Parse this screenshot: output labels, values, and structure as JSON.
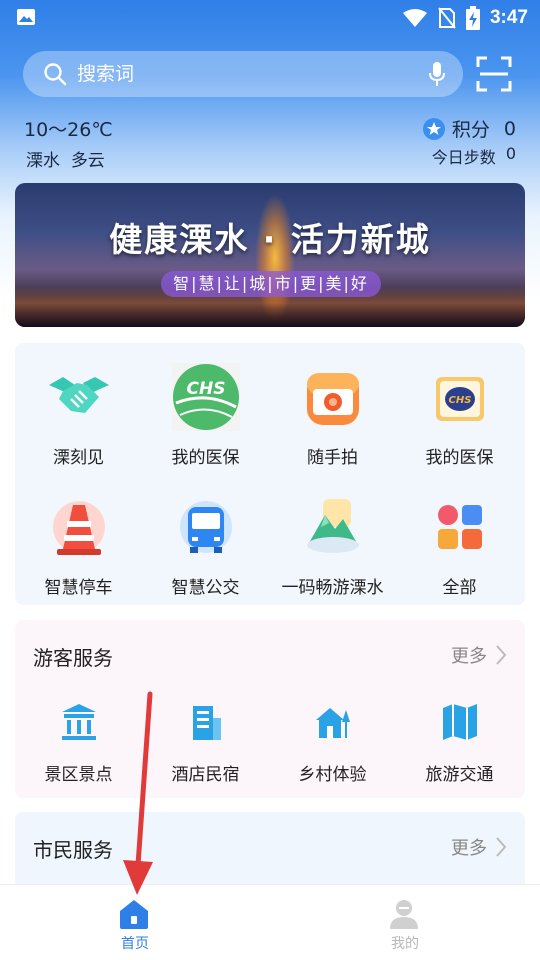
{
  "status_bar": {
    "time": "3:47"
  },
  "search": {
    "placeholder": "搜索词"
  },
  "weather": {
    "temperature": "10～26℃",
    "location": "溧水",
    "condition": "多云"
  },
  "points": {
    "label": "积分",
    "value": "0",
    "steps_label": "今日步数",
    "steps_value": "0"
  },
  "banner": {
    "title": "健康溧水 · 活力新城",
    "subtitle": "智|慧|让|城|市|更|美|好"
  },
  "apps": [
    {
      "label": "溧刻见",
      "icon": "handshake-icon"
    },
    {
      "label": "我的医保",
      "icon": "chs-green-icon"
    },
    {
      "label": "随手拍",
      "icon": "camera-icon"
    },
    {
      "label": "我的医保",
      "icon": "chs-card-icon"
    },
    {
      "label": "智慧停车",
      "icon": "traffic-cone-icon"
    },
    {
      "label": "智慧公交",
      "icon": "bus-icon"
    },
    {
      "label": "一码畅游溧水",
      "icon": "mountain-icon"
    },
    {
      "label": "全部",
      "icon": "grid-icon"
    }
  ],
  "tourist_service": {
    "title": "游客服务",
    "more": "更多",
    "items": [
      {
        "label": "景区景点",
        "icon": "temple-icon"
      },
      {
        "label": "酒店民宿",
        "icon": "building-icon"
      },
      {
        "label": "乡村体验",
        "icon": "house-icon"
      },
      {
        "label": "旅游交通",
        "icon": "map-icon"
      }
    ]
  },
  "citizen_service": {
    "title": "市民服务",
    "more": "更多"
  },
  "bottom_nav": {
    "home": {
      "label": "首页",
      "icon": "home-icon"
    },
    "mine": {
      "label": "我的",
      "icon": "profile-icon"
    }
  },
  "colors": {
    "primary": "#2f7fe8",
    "service_icon": "#2aa3e6"
  }
}
